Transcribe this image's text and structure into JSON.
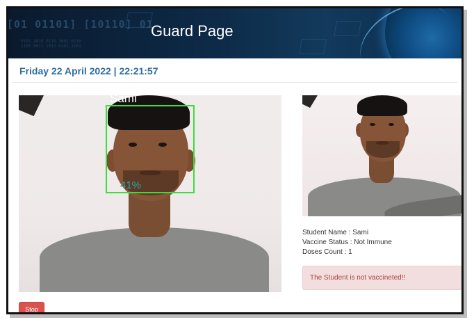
{
  "header": {
    "title": "Guard Page",
    "binary_text": "[01 01101]  [10110] 01",
    "binary_small": "0101 1010 0110 1001 0110\n1100 0011 1010 0101 1101"
  },
  "datetime": "Friday 22 April 2022 | 22:21:57",
  "camera": {
    "face_label": "Sami",
    "confidence": "41%"
  },
  "student": {
    "name_line": "Student Name : Sami",
    "status_line": "Vaccine Status : Not Immune",
    "doses_line": "Doses Count : 1"
  },
  "alert": {
    "message": "The Student is not vaccineted!!"
  },
  "actions": {
    "stop_label": "Stop"
  },
  "colors": {
    "header_bg": "#0d2a47",
    "datetime": "#2e6da4",
    "face_box": "#3ddc3d",
    "alert_bg": "#f2dede",
    "alert_text": "#a94442",
    "stop_button": "#d9534f"
  }
}
